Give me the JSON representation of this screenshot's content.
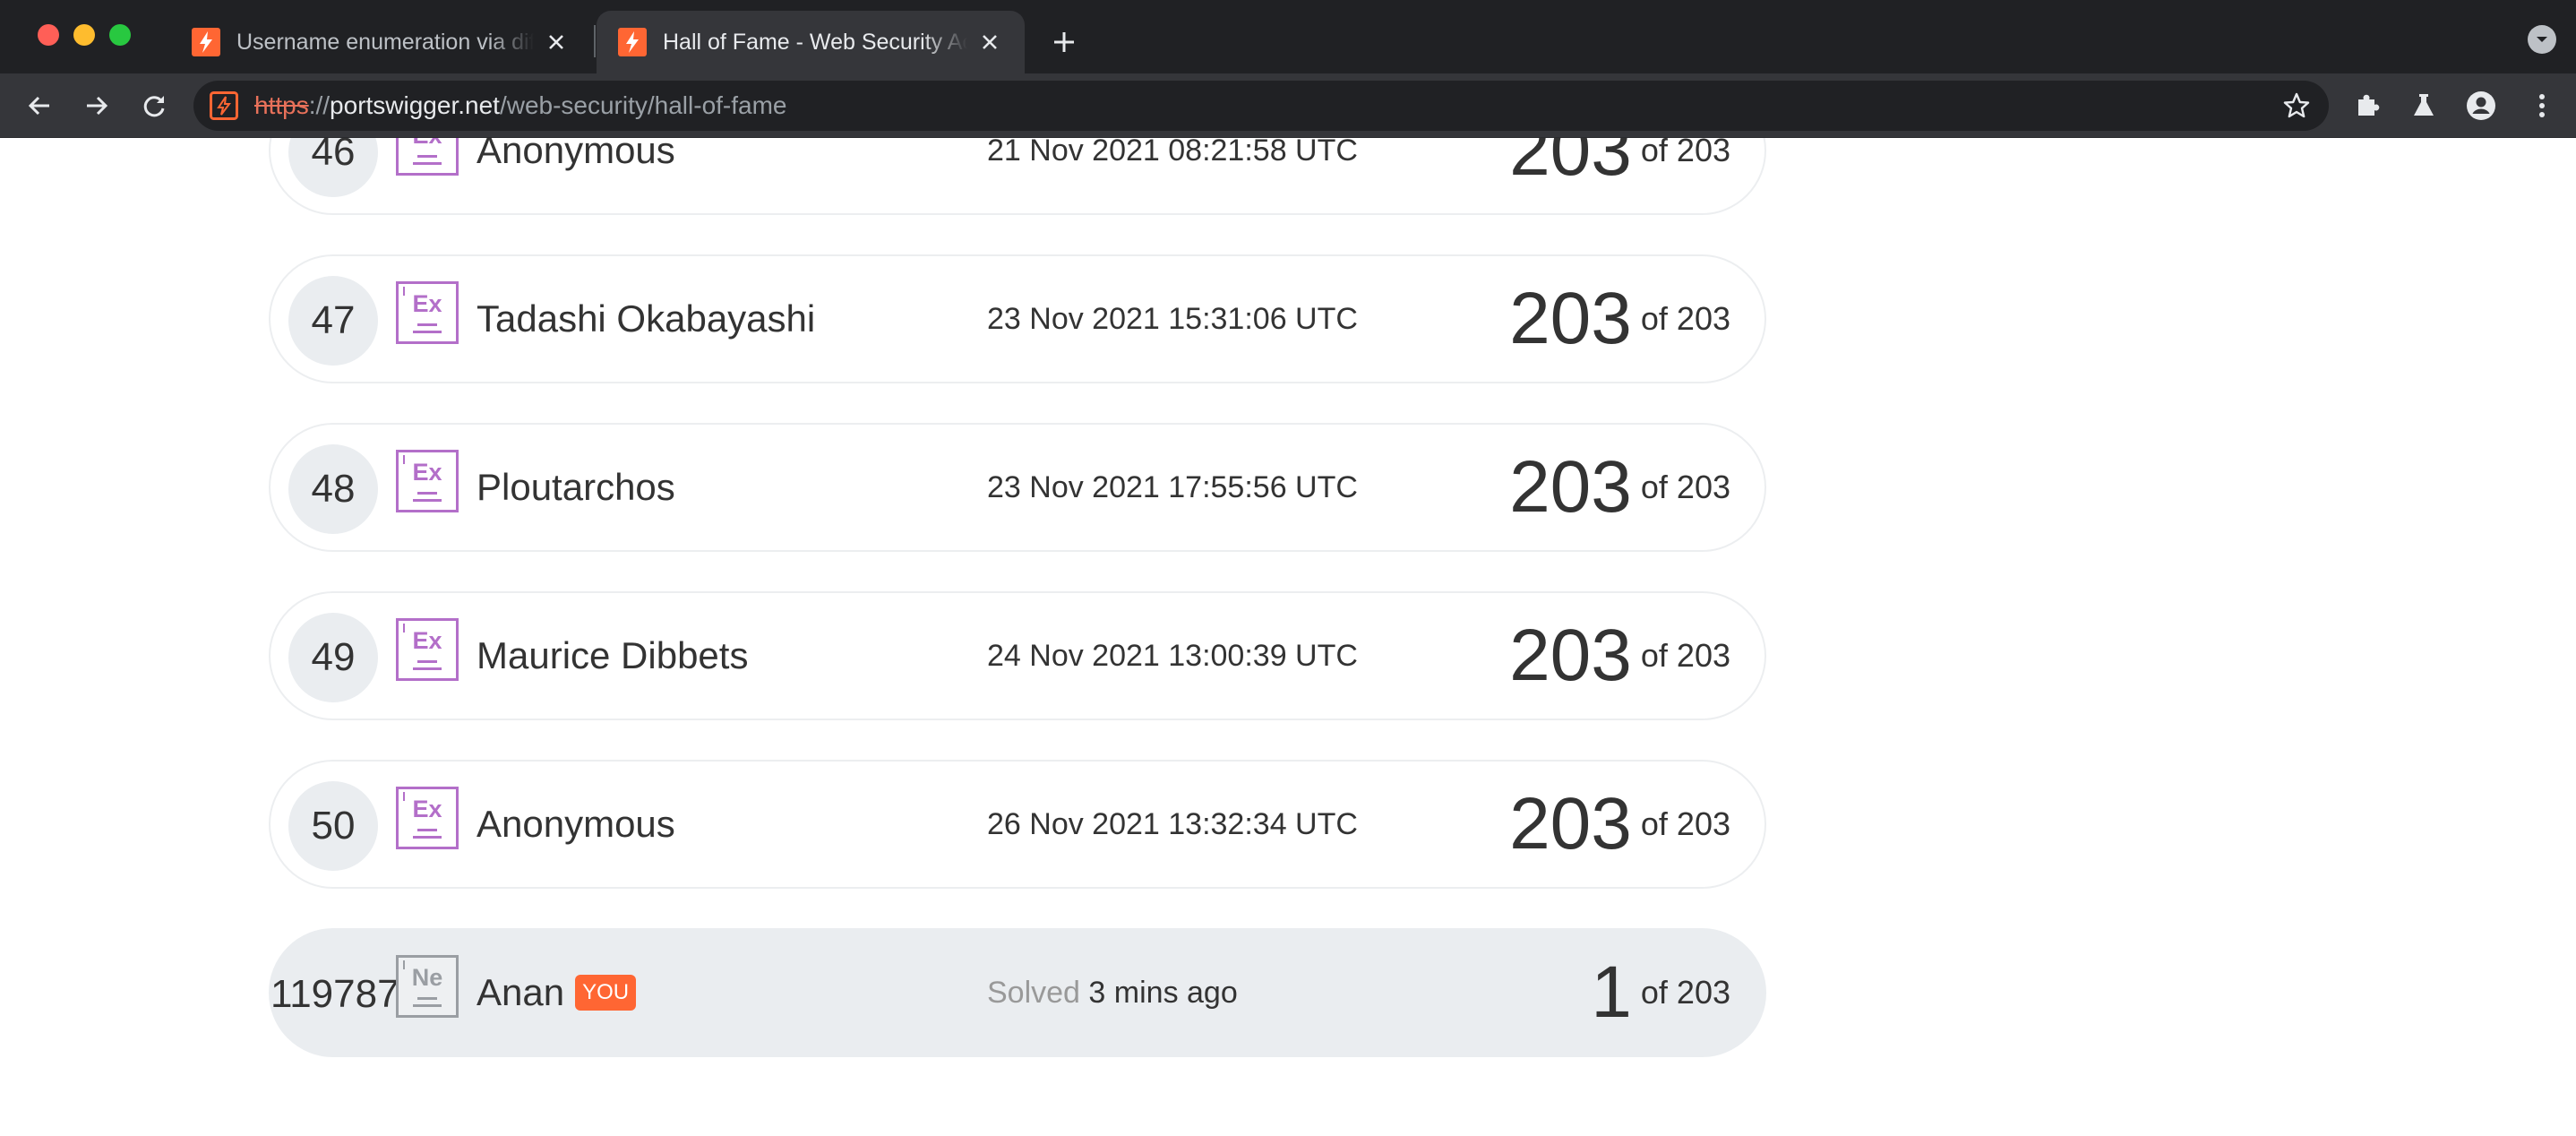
{
  "browser": {
    "tabs": [
      {
        "title": "Username enumeration via different responses",
        "active": false
      },
      {
        "title": "Hall of Fame - Web Security Academy",
        "active": true
      }
    ],
    "url": {
      "scheme": "https",
      "separator": "://",
      "host": "portswigger.net",
      "path": "/web-security/hall-of-fame"
    },
    "colors": {
      "accent": "#ff6633",
      "chrome_dark": "#202124",
      "chrome_toolbar": "#35363a"
    }
  },
  "leaderboard": {
    "rows": [
      {
        "rank": "46",
        "badge": "Ex",
        "name": "Anonymous",
        "date": "21 Nov 2021 08:21:58 UTC",
        "score": "203",
        "total": "of 203"
      },
      {
        "rank": "47",
        "badge": "Ex",
        "name": "Tadashi Okabayashi",
        "date": "23 Nov 2021 15:31:06 UTC",
        "score": "203",
        "total": "of 203"
      },
      {
        "rank": "48",
        "badge": "Ex",
        "name": "Ploutarchos",
        "date": "23 Nov 2021 17:55:56 UTC",
        "score": "203",
        "total": "of 203"
      },
      {
        "rank": "49",
        "badge": "Ex",
        "name": "Maurice Dibbets",
        "date": "24 Nov 2021 13:00:39 UTC",
        "score": "203",
        "total": "of 203"
      },
      {
        "rank": "50",
        "badge": "Ex",
        "name": "Anonymous",
        "date": "26 Nov 2021 13:32:34 UTC",
        "score": "203",
        "total": "of 203"
      }
    ],
    "you": {
      "rank": "119787",
      "badge": "Ne",
      "name": "Anan",
      "tag": "YOU",
      "solved_label": "Solved",
      "solved_time": "3 mins ago",
      "score": "1",
      "total": "of 203"
    }
  }
}
